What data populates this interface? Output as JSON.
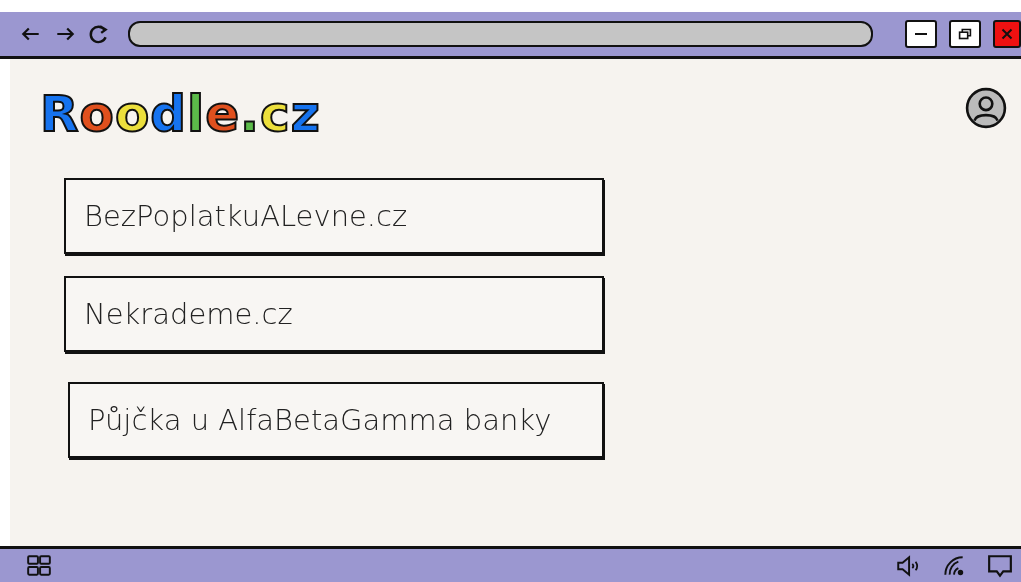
{
  "logo": {
    "letters": [
      {
        "text": "R",
        "color": "#1673ef"
      },
      {
        "text": "o",
        "color": "#e0501e"
      },
      {
        "text": "o",
        "color": "#ecdf3c"
      },
      {
        "text": "d",
        "color": "#1673ef"
      },
      {
        "text": "l",
        "color": "#5cbb4a"
      },
      {
        "text": "e",
        "color": "#e0501e"
      },
      {
        "text": ".",
        "color": "#5cbb4a"
      },
      {
        "text": "c",
        "color": "#ecdf3c"
      },
      {
        "text": "z",
        "color": "#1673ef"
      }
    ]
  },
  "results": [
    {
      "label": "BezPoplatkuALevne.cz"
    },
    {
      "label": "Nekrademe.cz"
    },
    {
      "label": "Půjčka u AlfaBetaGamma banky"
    }
  ]
}
